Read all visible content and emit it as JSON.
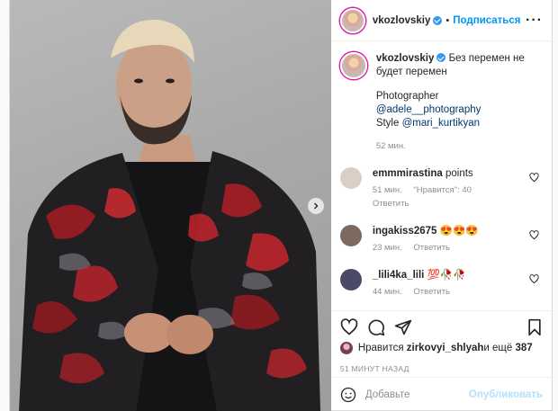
{
  "post": {
    "author": {
      "username": "vkozlovskiy",
      "follow_label": "Подписаться",
      "separator": "•",
      "more_label": "···"
    },
    "caption": {
      "username": "vkozlovskiy",
      "text": "Без перемен не будет перемен",
      "line2_prefix": "Photographer ",
      "line2_mention": "@adele__photography",
      "line3_prefix": "Style ",
      "line3_mention": "@mari_kurtikyan",
      "timestamp": "52 мин."
    },
    "comments": [
      {
        "username": "emmmirastina",
        "text": "points",
        "time": "51 мин.",
        "likes": "\"Нравится\": 40",
        "reply": "Ответить",
        "avatar_color": "#d9cfc6"
      },
      {
        "username": "ingakiss2675",
        "text": "😍😍😍",
        "time": "23 мин.",
        "likes": "",
        "reply": "Ответить",
        "avatar_color": "#7c6a5f"
      },
      {
        "username": "_lili4ka_lili",
        "text": "💯🥀🥀",
        "time": "44 мин.",
        "likes": "",
        "reply": "Ответить",
        "avatar_color": "#4a4a66"
      }
    ],
    "likes": {
      "prefix": "Нравится ",
      "user": "zirkovyi_shlyah",
      "middle": " и ещё ",
      "count": "387"
    },
    "posted_ago": "51 МИНУТ НАЗАД",
    "add_comment": {
      "placeholder": "Добавьте",
      "publish_label": "Опубликовать"
    }
  },
  "icons": [
    "heart-icon",
    "comment-icon",
    "share-icon",
    "bookmark-icon",
    "emoji-icon",
    "chevron-right-icon",
    "verified-icon",
    "more-icon"
  ]
}
